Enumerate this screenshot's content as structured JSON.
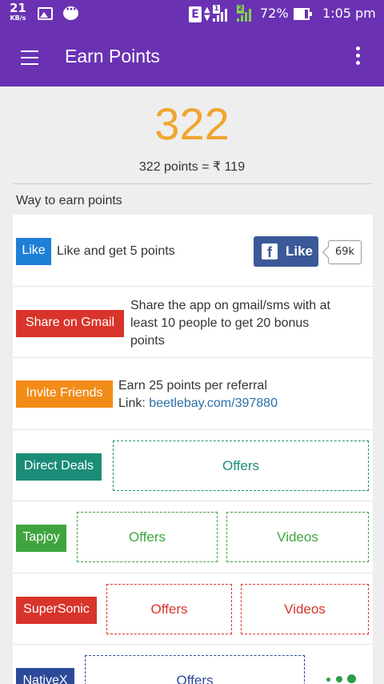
{
  "status_bar": {
    "speed_value": "21",
    "speed_unit": "KB/s",
    "network_type": "E",
    "sim1_tag": "1",
    "sim2_tag": "2",
    "battery_percent": "72%",
    "battery_level": 0.72,
    "time": "1:05 pm",
    "icons": [
      "gallery-icon",
      "chat-icon",
      "data-arrows-icon",
      "signal-icon",
      "battery-icon"
    ]
  },
  "app_bar": {
    "title": "Earn Points",
    "menu_icon": "menu-icon",
    "more_icon": "more-vert-icon"
  },
  "points": {
    "total": "322",
    "conversion": "322 points = ₹ 119"
  },
  "section_label": "Way to earn points",
  "rows": {
    "like": {
      "badge": "Like",
      "badge_color": "#1e7fd6",
      "text": "Like and get 5 points",
      "fb_button_label": "Like",
      "fb_icon": "facebook-icon",
      "fb_count": "69k"
    },
    "share": {
      "badge": "Share on Gmail",
      "badge_color": "#d8342b",
      "line1": "Share the app on gmail/sms with at",
      "line2": "least 10 people to get 20 bonus",
      "line3": "points"
    },
    "invite": {
      "badge": "Invite Friends",
      "badge_color": "#f28c18",
      "line1": "Earn 25 points per referral",
      "link_label": "Link: ",
      "link": "beetlebay.com/397880"
    },
    "direct_deals": {
      "badge": "Direct Deals",
      "badge_color": "#1a8c78",
      "offers": "Offers"
    },
    "tapjoy": {
      "badge": "Tapjoy",
      "badge_color": "#3fa43f",
      "offers": "Offers",
      "videos": "Videos"
    },
    "supersonic": {
      "badge": "SuperSonic",
      "badge_color": "#d8342b",
      "offers": "Offers",
      "videos": "Videos"
    },
    "nativex": {
      "badge": "NativeX",
      "badge_color": "#2d4a9a",
      "offers": "Offers"
    }
  }
}
